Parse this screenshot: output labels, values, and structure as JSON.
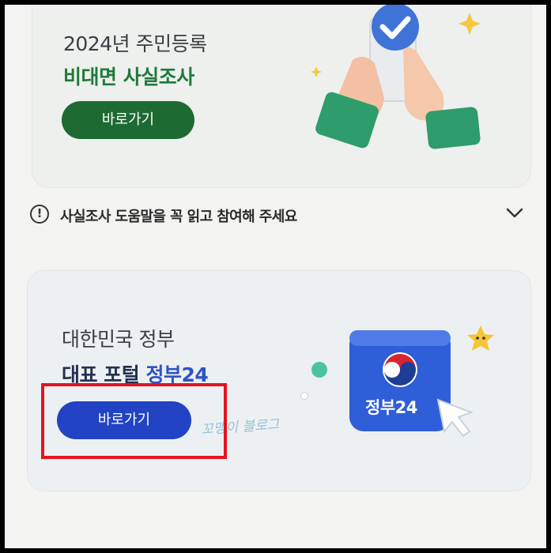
{
  "top_card": {
    "subtitle": "2024년 주민등록",
    "title": "비대면 사실조사",
    "button_label": "바로가기"
  },
  "notice": {
    "text": "사실조사 도움말을 꼭 읽고 참여해 주세요"
  },
  "bottom_card": {
    "subtitle": "대한민국 정부",
    "title_prefix": "대표 포털",
    "title_highlight": "정부24",
    "button_label": "바로가기",
    "app_icon_label": "정부24"
  },
  "watermark": "꼬맹이 블로그",
  "colors": {
    "green_button": "#1d6b32",
    "blue_button": "#2243c4",
    "highlight_border": "#e2151f",
    "app_icon_blue": "#2f5ed9"
  }
}
